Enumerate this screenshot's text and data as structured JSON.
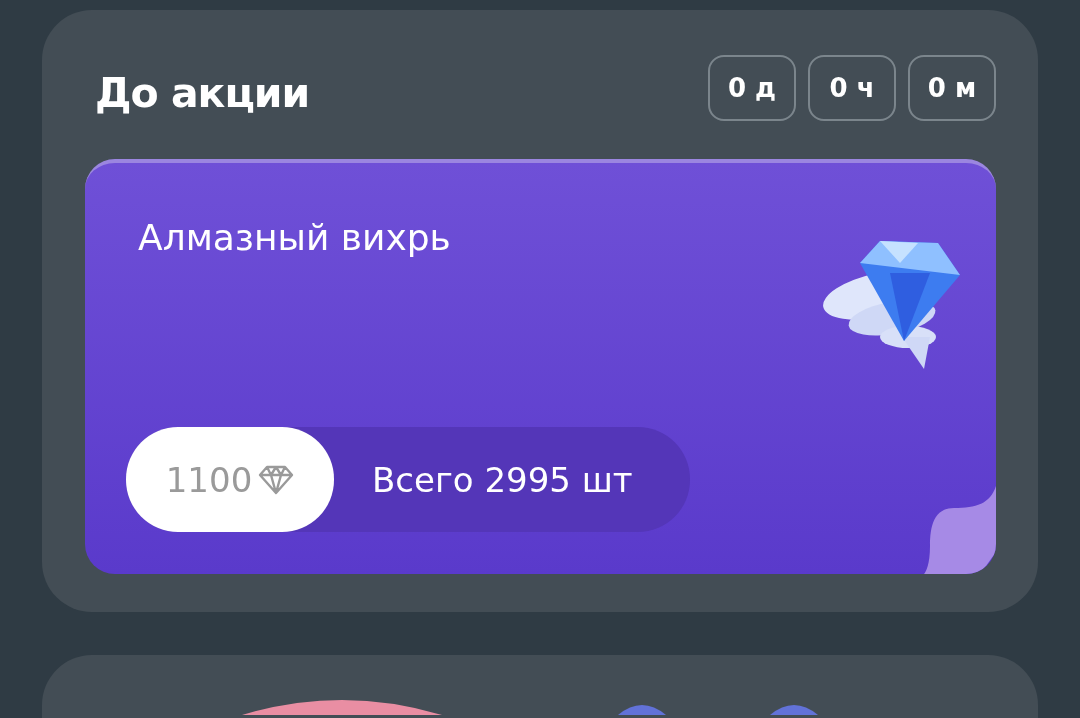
{
  "header": {
    "title": "До акции",
    "timer": [
      "0 д",
      "0 ч",
      "0 м"
    ]
  },
  "promo": {
    "title": "Алмазный вихрь",
    "price": "1100",
    "total": "Всего 2995 шт"
  }
}
